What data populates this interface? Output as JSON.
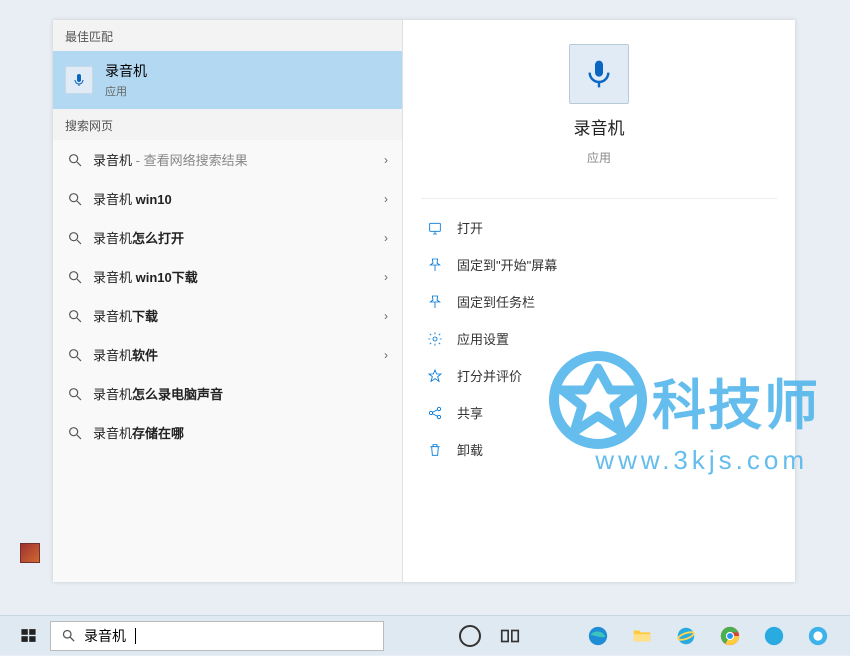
{
  "section_headers": {
    "best_match": "最佳匹配",
    "web": "搜索网页"
  },
  "best_match": {
    "title": "录音机",
    "subtitle": "应用"
  },
  "web_results": [
    {
      "prefix": "录音机",
      "bold": "",
      "suffix": " - 查看网络搜索结果",
      "has_chev": true
    },
    {
      "prefix": "录音机 ",
      "bold": "win10",
      "suffix": "",
      "has_chev": true
    },
    {
      "prefix": "录音机",
      "bold": "怎么打开",
      "suffix": "",
      "has_chev": true
    },
    {
      "prefix": "录音机 ",
      "bold": "win10下载",
      "suffix": "",
      "has_chev": true
    },
    {
      "prefix": "录音机",
      "bold": "下载",
      "suffix": "",
      "has_chev": true
    },
    {
      "prefix": "录音机",
      "bold": "软件",
      "suffix": "",
      "has_chev": true
    },
    {
      "prefix": "录音机",
      "bold": "怎么录电脑声音",
      "suffix": "",
      "has_chev": false
    },
    {
      "prefix": "录音机",
      "bold": "存储在哪",
      "suffix": "",
      "has_chev": false
    }
  ],
  "details": {
    "title": "录音机",
    "subtitle": "应用"
  },
  "actions": [
    {
      "icon": "open",
      "label": "打开"
    },
    {
      "icon": "pin-start",
      "label": "固定到\"开始\"屏幕"
    },
    {
      "icon": "pin-taskbar",
      "label": "固定到任务栏"
    },
    {
      "icon": "settings",
      "label": "应用设置"
    },
    {
      "icon": "rate",
      "label": "打分并评价"
    },
    {
      "icon": "share",
      "label": "共享"
    },
    {
      "icon": "uninstall",
      "label": "卸载"
    }
  ],
  "search_input": "录音机",
  "watermark": {
    "text": "科技师",
    "url": "www.3kjs.com"
  }
}
